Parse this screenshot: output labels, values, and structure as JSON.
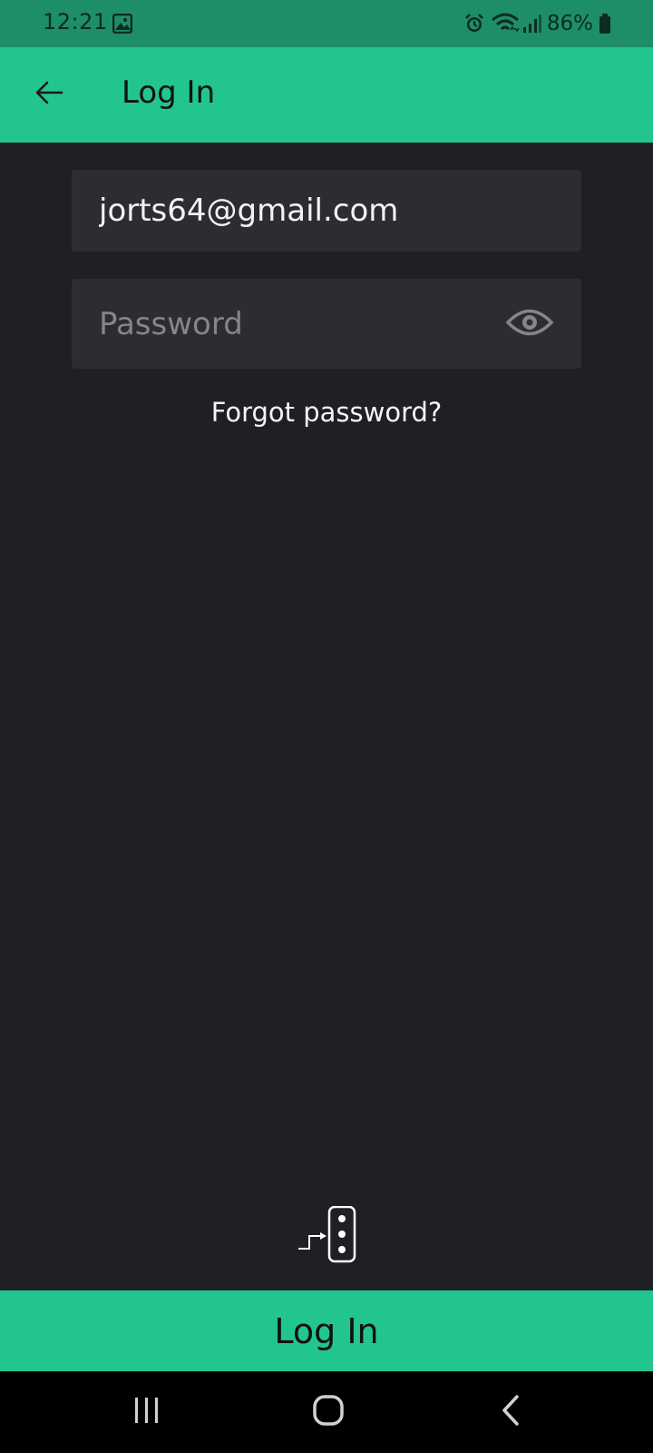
{
  "status_bar": {
    "time": "12:21",
    "battery_percent": "86%",
    "icons": [
      "gallery-icon",
      "alarm-icon",
      "wifi-icon",
      "signal-icon",
      "battery-icon"
    ]
  },
  "app_bar": {
    "title": "Log In",
    "back_icon": "arrow-left-icon"
  },
  "form": {
    "email_value": "jorts64@gmail.com",
    "password_placeholder": "Password",
    "password_value": "",
    "visibility_icon": "eye-icon",
    "forgot_label": "Forgot password?"
  },
  "logo_icon": "app-logo-icon",
  "login_button_label": "Log In",
  "nav": {
    "recents_icon": "recents-icon",
    "home_icon": "home-icon",
    "back_icon": "back-chevron-icon"
  },
  "colors": {
    "accent": "#22c58e",
    "status_bar": "#1e8e67",
    "background": "#1f2024",
    "field_background": "#2c2d32"
  }
}
